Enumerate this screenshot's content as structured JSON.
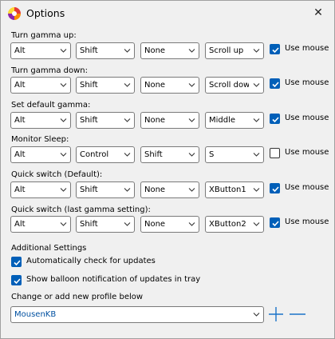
{
  "window": {
    "title": "Options",
    "close_glyph": "✕"
  },
  "rows": [
    {
      "label": "Turn gamma up:",
      "mod1": "Alt",
      "mod2": "Shift",
      "mod3": "None",
      "key": "Scroll up",
      "use_mouse": true,
      "use_mouse_label": "Use mouse"
    },
    {
      "label": "Turn gamma down:",
      "mod1": "Alt",
      "mod2": "Shift",
      "mod3": "None",
      "key": "Scroll down",
      "use_mouse": true,
      "use_mouse_label": "Use mouse"
    },
    {
      "label": "Set default gamma:",
      "mod1": "Alt",
      "mod2": "Shift",
      "mod3": "None",
      "key": "Middle",
      "use_mouse": true,
      "use_mouse_label": "Use mouse"
    },
    {
      "label": "Monitor Sleep:",
      "mod1": "Alt",
      "mod2": "Control",
      "mod3": "Shift",
      "key": "S",
      "use_mouse": false,
      "use_mouse_label": "Use mouse"
    },
    {
      "label": "Quick switch (Default):",
      "mod1": "Alt",
      "mod2": "Shift",
      "mod3": "None",
      "key": "XButton1",
      "use_mouse": true,
      "use_mouse_label": "Use mouse"
    },
    {
      "label": "Quick switch (last gamma setting):",
      "mod1": "Alt",
      "mod2": "Shift",
      "mod3": "None",
      "key": "XButton2",
      "use_mouse": true,
      "use_mouse_label": "Use mouse"
    }
  ],
  "additional": {
    "heading": "Additional Settings",
    "auto_check_label": "Automatically check for updates",
    "auto_check": true,
    "balloon_label": "Show balloon notification of updates in tray",
    "balloon": true
  },
  "profile": {
    "label": "Change or add new profile below",
    "value": "MousenKB",
    "add_icon": "plus-icon",
    "remove_icon": "minus-icon"
  },
  "colors": {
    "accent": "#005fb8",
    "profile_text": "#0050a0"
  }
}
